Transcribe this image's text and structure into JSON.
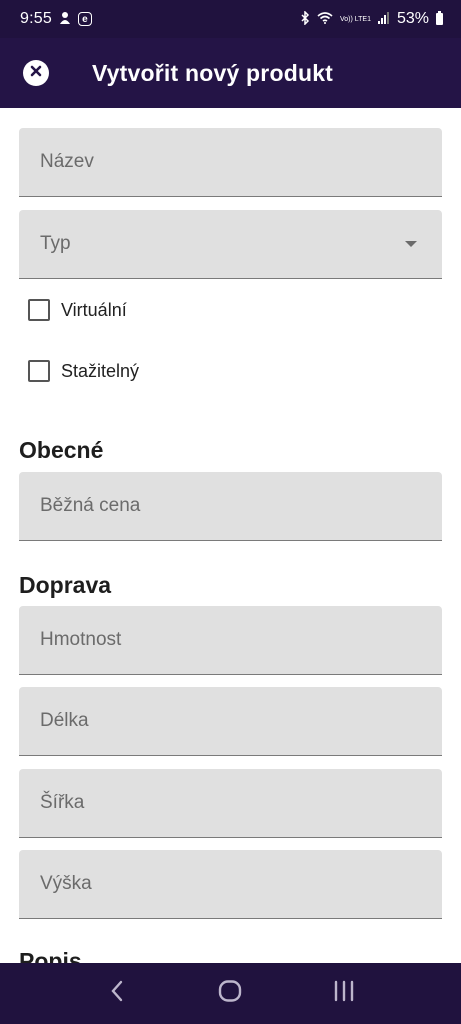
{
  "status_bar": {
    "time": "9:55",
    "battery": "53%",
    "volte": "Vo)) LTE1"
  },
  "app_bar": {
    "title": "Vytvořit nový produkt"
  },
  "form": {
    "name_label": "Název",
    "type_label": "Typ",
    "virtual_label": "Virtuální",
    "downloadable_label": "Stažitelný"
  },
  "sections": {
    "general_title": "Obecné",
    "shipping_title": "Doprava",
    "next_title": "Popis"
  },
  "general": {
    "regular_price_label": "Běžná cena"
  },
  "shipping": {
    "weight_label": "Hmotnost",
    "length_label": "Délka",
    "width_label": "Šířka",
    "height_label": "Výška"
  },
  "colors": {
    "bar": "#20123e",
    "field_bg": "#e0e0e0"
  }
}
